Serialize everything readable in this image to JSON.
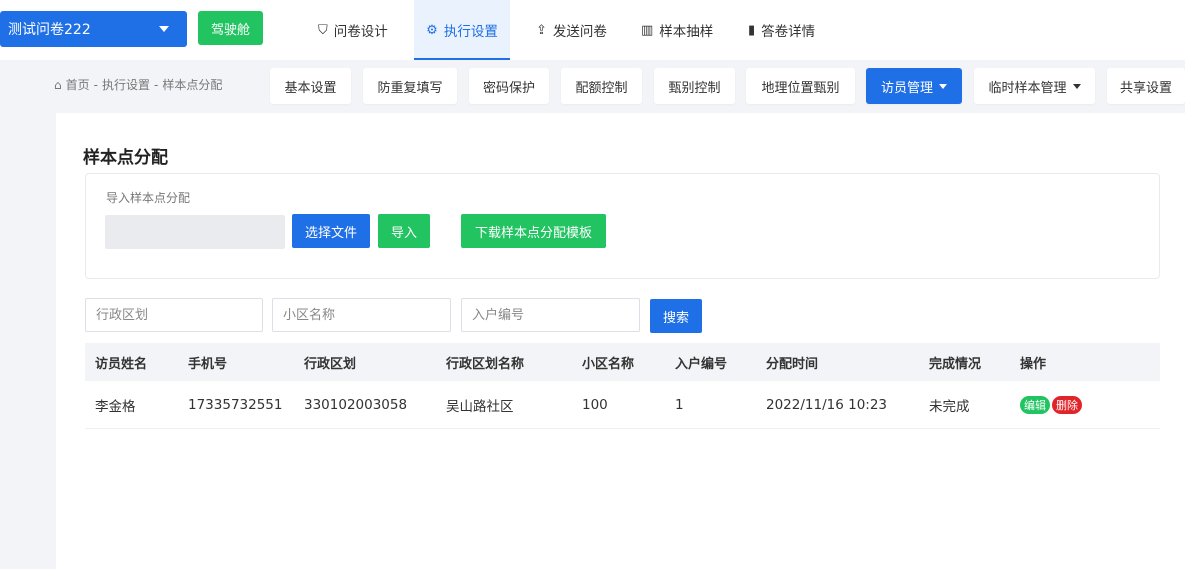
{
  "topbar": {
    "survey_name": "测试问卷222",
    "cockpit_label": "驾驶舱",
    "tabs": [
      {
        "icon": "shield-icon",
        "glyph": "⛉",
        "label": "问卷设计"
      },
      {
        "icon": "settings-icon",
        "glyph": "⚙",
        "label": "执行设置"
      },
      {
        "icon": "share-icon",
        "glyph": "⇪",
        "label": "发送问卷"
      },
      {
        "icon": "sample-icon",
        "glyph": "▥",
        "label": "样本抽样"
      },
      {
        "icon": "bar-chart-icon",
        "glyph": "▮",
        "label": "答卷详情"
      }
    ],
    "active_tab": "执行设置"
  },
  "breadcrumb": {
    "home_icon": "home-icon",
    "items": [
      "首页",
      "执行设置",
      "样本点分配"
    ],
    "separator": "-"
  },
  "subtabs": [
    {
      "label": "基本设置"
    },
    {
      "label": "防重复填写"
    },
    {
      "label": "密码保护"
    },
    {
      "label": "配额控制"
    },
    {
      "label": "甄别控制"
    },
    {
      "label": "地理位置甄别"
    },
    {
      "label": "访员管理"
    },
    {
      "label": "临时样本管理"
    },
    {
      "label": "共享设置"
    }
  ],
  "active_subtab": "访员管理",
  "main": {
    "title": "样本点分配",
    "import": {
      "label": "导入样本点分配",
      "choose_file": "选择文件",
      "import_button": "导入",
      "download_template": "下载样本点分配模板"
    },
    "filters": {
      "district_placeholder": "行政区划",
      "community_placeholder": "小区名称",
      "household_placeholder": "入户编号",
      "search_button": "搜索"
    },
    "table": {
      "columns": [
        "访员姓名",
        "手机号",
        "行政区划",
        "行政区划名称",
        "小区名称",
        "入户编号",
        "分配时间",
        "完成情况",
        "操作"
      ],
      "rows": [
        {
          "name": "李金格",
          "phone": "17335732551",
          "district_code": "330102003058",
          "district_name": "吴山路社区",
          "community": "100",
          "household": "1",
          "assigned_at": "2022/11/16 10:23",
          "status": "未完成",
          "edit_label": "编辑",
          "delete_label": "删除"
        }
      ]
    }
  },
  "colors": {
    "primary": "#1f6fe6",
    "success": "#22c361",
    "danger": "#e0242a"
  }
}
